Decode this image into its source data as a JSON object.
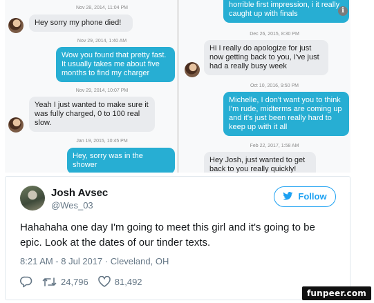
{
  "left_chat": {
    "items": [
      {
        "kind": "timestamp",
        "text": "Nov 28, 2014, 11:04 PM"
      },
      {
        "kind": "incoming",
        "text": "Hey sorry my phone died!"
      },
      {
        "kind": "timestamp",
        "text": "Nov 29, 2014, 1:40 AM"
      },
      {
        "kind": "outgoing",
        "text": "Wow you found that pretty fast. It usually takes me about  five months to find my charger"
      },
      {
        "kind": "timestamp",
        "text": "Nov 29, 2014, 10:07 PM"
      },
      {
        "kind": "incoming",
        "text": "Yeah I just wanted to make sure it was fully charged, 0 to 100 real slow."
      },
      {
        "kind": "timestamp",
        "text": "Jan 19, 2015, 10:45 PM"
      },
      {
        "kind": "outgoing",
        "text": "Hey, sorry was in the shower"
      }
    ]
  },
  "right_chat": {
    "items": [
      {
        "kind": "outgoing",
        "text": "horrible first impression, i it really caught up with finals"
      },
      {
        "kind": "timestamp",
        "text": "Dec 26, 2015, 8:30 PM"
      },
      {
        "kind": "incoming",
        "text": "Hi I really do apologize for just now getting back to you, I've just had a really busy week"
      },
      {
        "kind": "timestamp",
        "text": "Oct 10, 2016, 9:50 PM"
      },
      {
        "kind": "outgoing",
        "text": "Michelle, I don't want you to think I'm rude, midterms are coming up and it's just been really hard to keep up with it all"
      },
      {
        "kind": "timestamp",
        "text": "Feb 22, 2017, 1:58 AM"
      },
      {
        "kind": "incoming",
        "text": "Hey Josh, just wanted to get back to you really quickly!"
      }
    ],
    "info_icon": "info-icon"
  },
  "tweet": {
    "name": "Josh Avsec",
    "handle": "@Wes_03",
    "follow_label": "Follow",
    "text": "Hahahaha one day I'm going to meet this girl and it's going to be epic. Look at the dates of our tinder texts.",
    "meta": "8:21 AM - 8 Jul 2017 · Cleveland, OH",
    "retweets": "24,796",
    "likes": "81,492"
  },
  "watermark": "funpeer.com",
  "colors": {
    "outgoing_bubble": "#27aed3",
    "incoming_bubble": "#e9ebee",
    "twitter_blue": "#1da1f2"
  }
}
